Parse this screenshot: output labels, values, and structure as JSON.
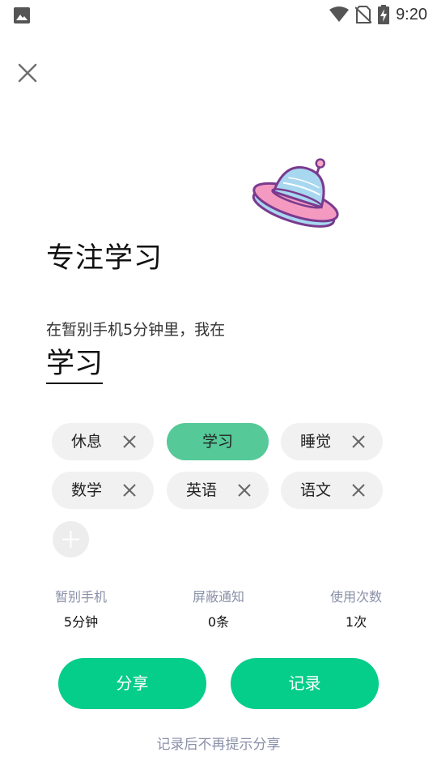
{
  "status_bar": {
    "time": "9:20",
    "icons": [
      "image-icon",
      "wifi-icon",
      "no-sim-icon",
      "battery-charging-icon"
    ]
  },
  "header": {
    "close_icon": "close-icon"
  },
  "illustration": "ufo-illustration",
  "main": {
    "title": "专注学习",
    "subtitle": "在暂别手机5分钟里，我在",
    "current_activity": "学习"
  },
  "tags": [
    {
      "label": "休息",
      "selected": false
    },
    {
      "label": "学习",
      "selected": true
    },
    {
      "label": "睡觉",
      "selected": false
    },
    {
      "label": "数学",
      "selected": false
    },
    {
      "label": "英语",
      "selected": false
    },
    {
      "label": "语文",
      "selected": false
    }
  ],
  "add_tag_icon": "plus-icon",
  "stats": [
    {
      "label": "暂别手机",
      "value": "5分钟"
    },
    {
      "label": "屏蔽通知",
      "value": "0条"
    },
    {
      "label": "使用次数",
      "value": "1次"
    }
  ],
  "actions": {
    "share_label": "分享",
    "record_label": "记录"
  },
  "footer": {
    "note": "记录后不再提示分享"
  },
  "colors": {
    "selected_chip": "#55c998",
    "primary_button": "#05cd8a",
    "chip_background": "#f1f1f1",
    "muted_text": "#8a90a8"
  }
}
